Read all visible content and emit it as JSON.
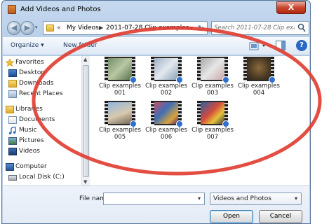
{
  "window": {
    "title": "Add Videos and Photos",
    "close_glyph": "X"
  },
  "nav": {
    "back_glyph": "◀",
    "forward_glyph": "▶",
    "breadcrumb_chevron": "«",
    "breadcrumb": [
      "My Videos",
      "2011-07-28 Clip examples"
    ],
    "separator": "▶",
    "dropdown_glyph": "▾",
    "refresh_glyph": "↻",
    "search_placeholder": "Search 2011-07-28 Clip examp..."
  },
  "toolbar": {
    "organize_label": "Organize ▾",
    "new_folder_label": "New folder",
    "help_glyph": "?"
  },
  "sidebar": {
    "items": [
      {
        "label": "Favorites",
        "icon": "star-icon"
      },
      {
        "label": "Desktop",
        "icon": "desktop-icon"
      },
      {
        "label": "Downloads",
        "icon": "downloads-icon"
      },
      {
        "label": "Recent Places",
        "icon": "recent-places-icon"
      },
      {
        "label": "Libraries",
        "icon": "libraries-icon"
      },
      {
        "label": "Documents",
        "icon": "documents-icon"
      },
      {
        "label": "Music",
        "icon": "music-icon"
      },
      {
        "label": "Pictures",
        "icon": "pictures-icon"
      },
      {
        "label": "Videos",
        "icon": "videos-icon"
      },
      {
        "label": "Computer",
        "icon": "computer-icon"
      },
      {
        "label": "Local Disk (C:)",
        "icon": "local-disk-icon"
      }
    ],
    "scroll_up": "▲",
    "scroll_down": "▼"
  },
  "files": [
    {
      "line1": "Clip examples",
      "line2": "001"
    },
    {
      "line1": "Clip examples",
      "line2": "002"
    },
    {
      "line1": "Clip examples",
      "line2": "003"
    },
    {
      "line1": "Clip examples",
      "line2": "004"
    },
    {
      "line1": "Clip examples",
      "line2": "005"
    },
    {
      "line1": "Clip examples",
      "line2": "006"
    },
    {
      "line1": "Clip examples",
      "line2": "007"
    }
  ],
  "bottom": {
    "filename_label": "File name:",
    "filename_value": "",
    "dropdown_glyph": "▾",
    "filetype_value": "Videos and Photos",
    "open_label": "Open",
    "cancel_label": "Cancel"
  },
  "colors": {
    "annotation": "#e03b2f",
    "title_bar": "#aac4e3",
    "accent": "#2e6fcf"
  }
}
